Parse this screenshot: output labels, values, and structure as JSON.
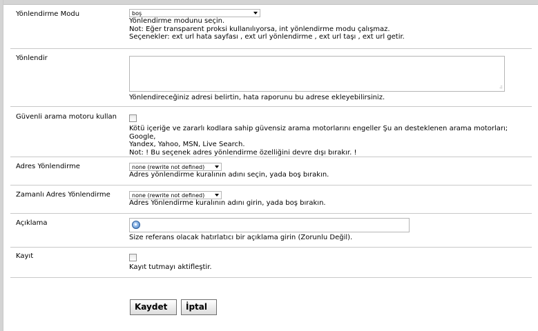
{
  "rows": [
    {
      "label": "Yönlendirme Modu",
      "select_value": "boş",
      "help": [
        "Yönlendirme modunu seçin.",
        "Not: Eğer transparent proksi kullanılıyorsa, int yönlendirme modu çalışmaz.",
        "Seçenekler: ext url hata sayfası , ext url yönlendirme , ext url taşı , ext url getir."
      ]
    },
    {
      "label": "Yönlendir",
      "textarea_value": "",
      "help": [
        "Yönlendireceğiniz adresi belirtin, hata raporunu bu adrese ekleyebilirsiniz."
      ]
    },
    {
      "label": "Güvenli arama motoru kullan",
      "checked": false,
      "help": [
        "Kötü içeriğe ve zararlı kodlara sahip güvensiz arama motorlarını engeller Şu an desteklenen arama motorları; Google,",
        "Yandex, Yahoo, MSN, Live Search.",
        "Not: ! Bu seçenek adres yönlendirme özelliğini devre dışı bırakır. !"
      ]
    },
    {
      "label": "Adres Yönlendirme",
      "select_value": "none (rewrite not defined)",
      "help": [
        "Adres yönlendirme kuralının adını seçin, yada boş bırakın."
      ]
    },
    {
      "label": "Zamanlı Adres Yönlendirme",
      "select_value": "none (rewrite not defined)",
      "help": [
        "Adres Yönlendirme kuralının adını girin, yada boş bırakın."
      ]
    },
    {
      "label": "Açıklama",
      "input_value": "",
      "input_icon": "tag-icon",
      "help": [
        "Size referans olacak hatırlatıcı bir açıklama girin (Zorunlu Değil)."
      ]
    },
    {
      "label": "Kayıt",
      "checked": false,
      "help": [
        "Kayıt tutmayı aktifleştir."
      ]
    }
  ],
  "buttons": {
    "save": "Kaydet",
    "cancel": "İptal"
  }
}
